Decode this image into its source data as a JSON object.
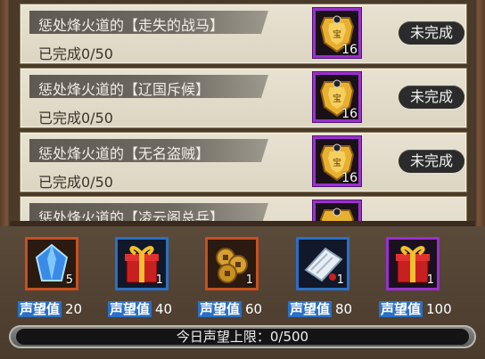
{
  "tasks": [
    {
      "title": "惩处烽火道的【走失的战马】",
      "progress": "已完成0/50",
      "reward_count": "16",
      "status": "未完成"
    },
    {
      "title": "惩处烽火道的【辽国斥候】",
      "progress": "已完成0/50",
      "reward_count": "16",
      "status": "未完成"
    },
    {
      "title": "惩处烽火道的【无名盗贼】",
      "progress": "已完成0/50",
      "reward_count": "16",
      "status": "未完成"
    },
    {
      "title": "惩处烽火道的【凌云阁总兵】",
      "progress": "",
      "reward_count": "",
      "status": ""
    }
  ],
  "rewards": [
    {
      "icon": "blue-crystal-icon",
      "count": "5",
      "label": "声望值",
      "value": "20",
      "border": "#c8501e"
    },
    {
      "icon": "red-gift-box-icon",
      "count": "1",
      "label": "声望值",
      "value": "40",
      "border": "#2a70c6"
    },
    {
      "icon": "gold-coins-icon",
      "count": "1",
      "label": "声望值",
      "value": "60",
      "border": "#c8501e"
    },
    {
      "icon": "scroll-icon",
      "count": "1",
      "label": "声望值",
      "value": "80",
      "border": "#2a70c6"
    },
    {
      "icon": "red-gift-box-icon",
      "count": "1",
      "label": "声望值",
      "value": "100",
      "border": "#9b2fd0"
    }
  ],
  "daily_limit": "今日声望上限：0/500",
  "colors": {
    "purple_border": "#9b2fd0",
    "badge_blue": "#2a70c6"
  }
}
